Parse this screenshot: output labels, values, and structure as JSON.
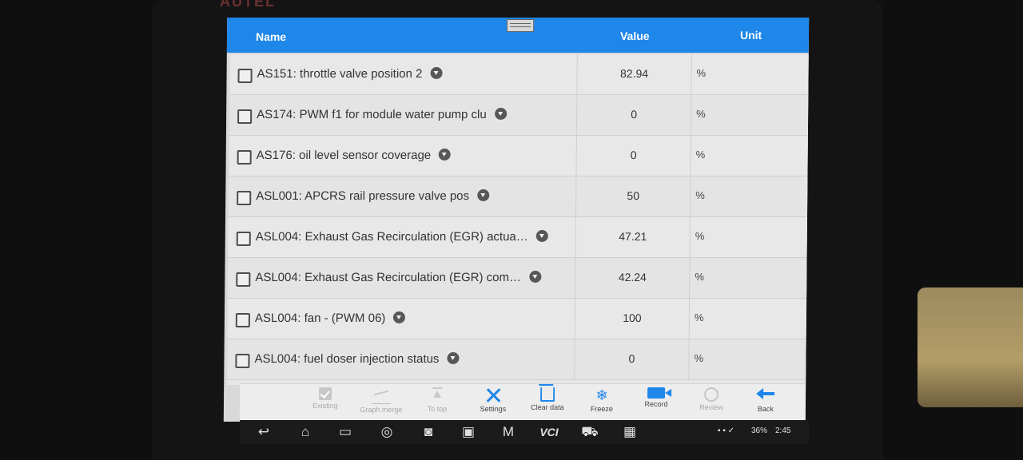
{
  "brand": "AUTEL",
  "table": {
    "headers": {
      "name": "Name",
      "value": "Value",
      "unit": "Unit"
    },
    "rows": [
      {
        "name": "AS151: throttle valve position 2",
        "value": "82.94",
        "unit": "%"
      },
      {
        "name": "AS174: PWM f1 for module water pump clu",
        "value": "0",
        "unit": "%"
      },
      {
        "name": "AS176: oil level sensor coverage",
        "value": "0",
        "unit": "%"
      },
      {
        "name": "ASL001: APCRS rail pressure valve pos",
        "value": "50",
        "unit": "%"
      },
      {
        "name": "ASL004: Exhaust Gas Recirculation (EGR) actua…",
        "value": "47.21",
        "unit": "%"
      },
      {
        "name": "ASL004: Exhaust Gas Recirculation (EGR) com…",
        "value": "42.24",
        "unit": "%"
      },
      {
        "name": "ASL004: fan - (PWM 06)",
        "value": "100",
        "unit": "%"
      },
      {
        "name": "ASL004: fuel doser injection status",
        "value": "0",
        "unit": "%"
      }
    ]
  },
  "toolbar": {
    "existing": "Existing",
    "graph_merge": "Graph merge",
    "to_top": "To top",
    "settings": "Settings",
    "clear_data": "Clear data",
    "freeze": "Freeze",
    "record": "Record",
    "review": "Review",
    "back": "Back"
  },
  "icons": {
    "snowflake": "❄"
  },
  "status_bar": {
    "battery": "36%",
    "time": "2:45"
  },
  "nav": {
    "back_glyph": "↩",
    "home_glyph": "⌂",
    "recent_glyph": "▭",
    "vci_label": "VCI"
  },
  "colors": {
    "accent": "#1f86ea"
  }
}
